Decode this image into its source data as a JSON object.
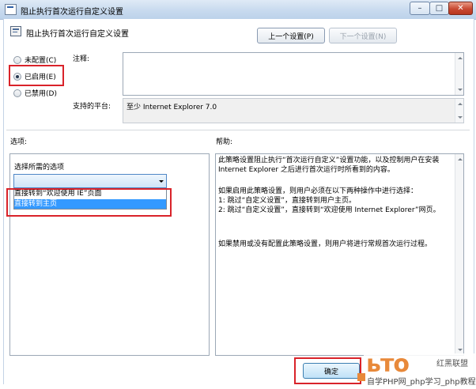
{
  "window": {
    "title": "阻止执行首次运行自定义设置",
    "minimize": "–",
    "maximize": "□",
    "close": "✕"
  },
  "header": {
    "policy_title": "阻止执行首次运行自定义设置",
    "prev_button": "上一个设置(P)",
    "next_button": "下一个设置(N)"
  },
  "state": {
    "options": [
      {
        "label": "未配置(C)",
        "selected": false
      },
      {
        "label": "已启用(E)",
        "selected": true
      },
      {
        "label": "已禁用(D)",
        "selected": false
      }
    ]
  },
  "comment": {
    "label": "注释:",
    "value": ""
  },
  "platform": {
    "label": "支持的平台:",
    "value": "至少 Internet Explorer 7.0"
  },
  "sections": {
    "options_label": "选项:",
    "help_label": "帮助:"
  },
  "options_pane": {
    "select_label": "选择所需的选项",
    "selected_value": "",
    "items": [
      "直接转到“欢迎使用 IE”页面",
      "直接转到主页"
    ],
    "highlighted_index": 1
  },
  "help": {
    "p1": "此策略设置阻止执行“首次运行自定义”设置功能，以及控制用户在安装 Internet Explorer 之后进行首次运行时所看到的内容。",
    "p2": "如果启用此策略设置，则用户必须在以下两种操作中进行选择：\n1: 跳过“自定义设置”，直接转到用户主页。\n2: 跳过“自定义设置”，直接转到“欢迎使用 Internet Explorer”网页。",
    "p3": "如果禁用或没有配置此策略设置，则用户将进行常规首次运行过程。"
  },
  "footer": {
    "ok_button": "确定"
  },
  "watermark": {
    "logo": "ьто",
    "logo2": "红黑联盟",
    "text": "自学PHP网_php学习_php教程"
  }
}
